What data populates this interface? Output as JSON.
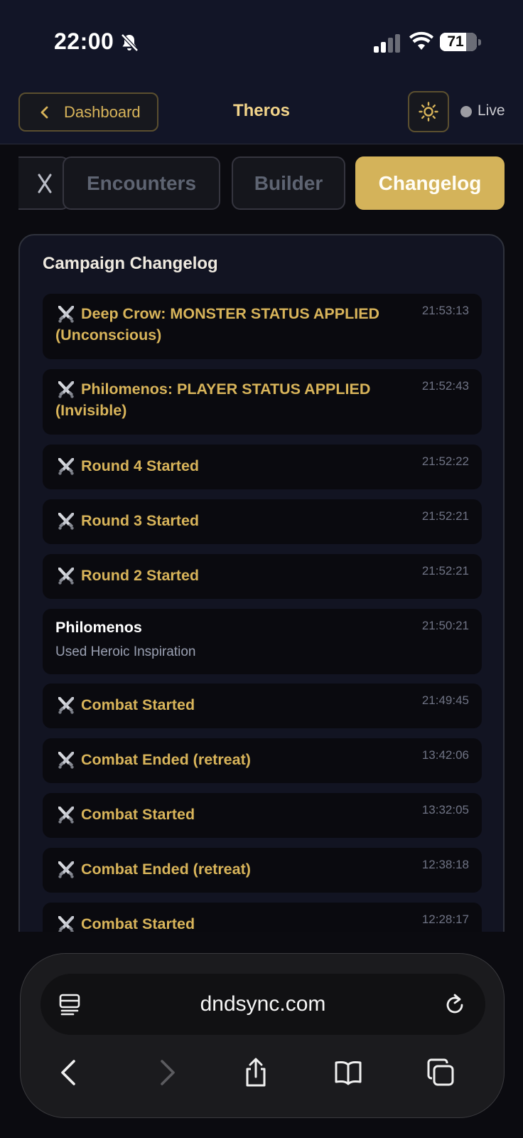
{
  "status_bar": {
    "time": "22:00",
    "battery": "71",
    "battery_level": 0.71
  },
  "header": {
    "back_label": "Dashboard",
    "title": "Theros",
    "live_label": "Live"
  },
  "tabs": [
    {
      "label": "Encounters",
      "active": false
    },
    {
      "label": "Builder",
      "active": false
    },
    {
      "label": "Changelog",
      "active": true
    }
  ],
  "changelog": {
    "title": "Campaign Changelog",
    "entries": [
      {
        "icon": "⚔️",
        "text": "Deep Crow: MONSTER STATUS APPLIED (Unconscious)",
        "time": "21:53:13"
      },
      {
        "icon": "⚔️",
        "text": "Philomenos: PLAYER STATUS APPLIED (Invisible)",
        "time": "21:52:43"
      },
      {
        "icon": "⚔️",
        "text": "Round 4 Started",
        "time": "21:52:22"
      },
      {
        "icon": "⚔️",
        "text": "Round 3 Started",
        "time": "21:52:21"
      },
      {
        "icon": "⚔️",
        "text": "Round 2 Started",
        "time": "21:52:21"
      },
      {
        "name": "Philomenos",
        "detail": "Used Heroic Inspiration",
        "time": "21:50:21"
      },
      {
        "icon": "⚔️",
        "text": "Combat Started",
        "time": "21:49:45"
      },
      {
        "icon": "⚔️",
        "text": "Combat Ended (retreat)",
        "time": "13:42:06"
      },
      {
        "icon": "⚔️",
        "text": "Combat Started",
        "time": "13:32:05"
      },
      {
        "icon": "⚔️",
        "text": "Combat Ended (retreat)",
        "time": "12:38:18"
      },
      {
        "icon": "⚔️",
        "text": "Combat Started",
        "time": "12:28:17"
      }
    ]
  },
  "browser": {
    "url": "dndsync.com"
  },
  "colors": {
    "accent": "#d4b35a",
    "header_bg": "#121527",
    "panel_bg": "#121422",
    "entry_bg": "#0a0a0f"
  }
}
